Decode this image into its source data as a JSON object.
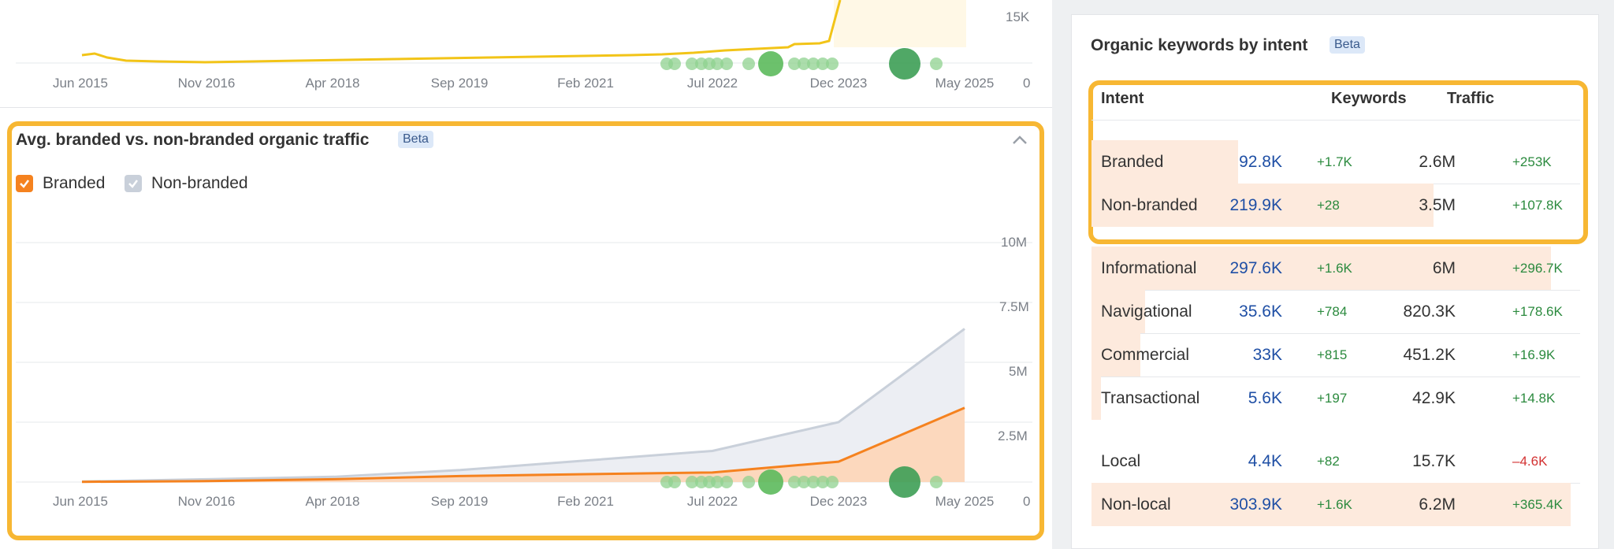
{
  "top_chart": {
    "x_ticks": [
      "Jun 2015",
      "Nov 2016",
      "Apr 2018",
      "Sep 2019",
      "Feb 2021",
      "Jul 2022",
      "Dec 2023",
      "May 2025"
    ],
    "y_ticks": [
      "15K",
      "0"
    ]
  },
  "branded_panel": {
    "title": "Avg. branded vs. non-branded organic traffic",
    "badge": "Beta",
    "legend": [
      {
        "label": "Branded",
        "color": "#f5821f",
        "checked": true
      },
      {
        "label": "Non-branded",
        "color": "#c9d0da",
        "checked": true
      }
    ],
    "chart_data": {
      "type": "area",
      "x": [
        "Jun 2015",
        "Nov 2016",
        "Apr 2018",
        "Sep 2019",
        "Feb 2021",
        "Jul 2022",
        "Dec 2023",
        "May 2025"
      ],
      "x_ticks": [
        "Jun 2015",
        "Nov 2016",
        "Apr 2018",
        "Sep 2019",
        "Feb 2021",
        "Jul 2022",
        "Dec 2023",
        "May 2025"
      ],
      "y_ticks": [
        "10M",
        "7.5M",
        "5M",
        "2.5M",
        "0"
      ],
      "ylim": [
        0,
        10000000
      ],
      "series": [
        {
          "name": "Branded",
          "color": "#f5821f",
          "values": [
            10000,
            40000,
            120000,
            250000,
            330000,
            400000,
            850000,
            3100000
          ]
        },
        {
          "name": "Non-branded",
          "color": "#c9d0da",
          "values": [
            20000,
            120000,
            220000,
            500000,
            900000,
            1300000,
            2500000,
            6400000
          ]
        }
      ]
    }
  },
  "intent_card": {
    "title": "Organic keywords by intent",
    "badge": "Beta",
    "headers": {
      "intent": "Intent",
      "keywords": "Keywords",
      "traffic": "Traffic"
    },
    "rows": [
      {
        "name": "Branded",
        "keywords": "92.8K",
        "kw_delta": "+1.7K",
        "traffic": "2.6M",
        "tr_delta": "+253K",
        "share": 0.3
      },
      {
        "name": "Non-branded",
        "keywords": "219.9K",
        "kw_delta": "+28",
        "traffic": "3.5M",
        "tr_delta": "+107.8K",
        "share": 0.7
      },
      {
        "name": "Informational",
        "keywords": "297.6K",
        "kw_delta": "+1.6K",
        "traffic": "6M",
        "tr_delta": "+296.7K",
        "share": 0.94
      },
      {
        "name": "Navigational",
        "keywords": "35.6K",
        "kw_delta": "+784",
        "traffic": "820.3K",
        "tr_delta": "+178.6K",
        "share": 0.11
      },
      {
        "name": "Commercial",
        "keywords": "33K",
        "kw_delta": "+815",
        "traffic": "451.2K",
        "tr_delta": "+16.9K",
        "share": 0.1
      },
      {
        "name": "Transactional",
        "keywords": "5.6K",
        "kw_delta": "+197",
        "traffic": "42.9K",
        "tr_delta": "+14.8K",
        "share": 0.02
      },
      {
        "name": "Local",
        "keywords": "4.4K",
        "kw_delta": "+82",
        "traffic": "15.7K",
        "tr_delta": "–4.6K",
        "share": 0.0
      },
      {
        "name": "Non-local",
        "keywords": "303.9K",
        "kw_delta": "+1.6K",
        "traffic": "6.2M",
        "tr_delta": "+365.4K",
        "share": 0.98
      }
    ]
  }
}
